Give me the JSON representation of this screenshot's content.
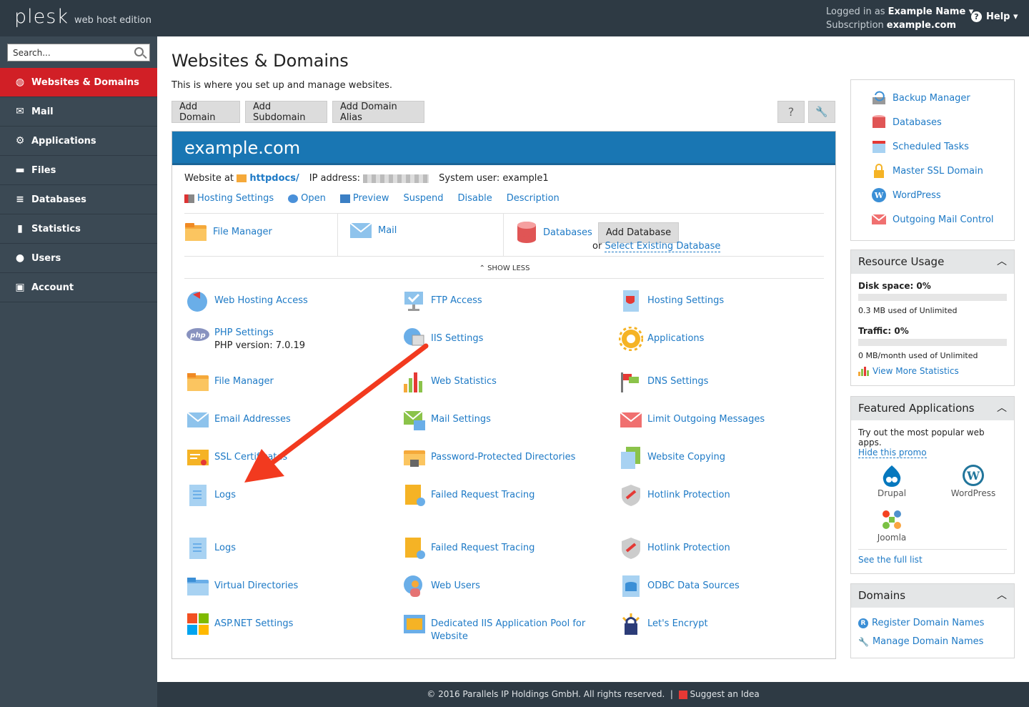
{
  "header": {
    "logo": "plesk",
    "edition": "web host edition",
    "logged_label": "Logged in as",
    "user": "Example Name ▾",
    "sub_label": "Subscription",
    "subscription": "example.com",
    "help": "Help ▾"
  },
  "search": {
    "placeholder": "Search..."
  },
  "nav": [
    {
      "label": "Websites & Domains",
      "icon": "globe-icon"
    },
    {
      "label": "Mail",
      "icon": "mail-icon"
    },
    {
      "label": "Applications",
      "icon": "gear-icon"
    },
    {
      "label": "Files",
      "icon": "folder-icon"
    },
    {
      "label": "Databases",
      "icon": "database-icon"
    },
    {
      "label": "Statistics",
      "icon": "chart-icon"
    },
    {
      "label": "Users",
      "icon": "user-icon"
    },
    {
      "label": "Account",
      "icon": "account-icon"
    }
  ],
  "page": {
    "title": "Websites & Domains",
    "desc": "This is where you set up and manage websites.",
    "btn_add_domain": "Add Domain",
    "btn_add_sub": "Add Subdomain",
    "btn_alias": "Add Domain Alias",
    "btn_help": "?"
  },
  "domain": {
    "name": "example.com",
    "website_at": "Website at",
    "httpdocs": "httpdocs/",
    "ip_label": "IP address:",
    "sysuser_label": "System user:",
    "sysuser": "example1",
    "actions": [
      "Hosting Settings",
      "Open",
      "Preview",
      "Suspend",
      "Disable",
      "Description"
    ],
    "quick": {
      "fm": "File Manager",
      "mail": "Mail",
      "db": "Databases",
      "add_db": "Add Database",
      "or": "or",
      "select_db": "Select Existing Database"
    },
    "show_less": "SHOW LESS",
    "tools": [
      [
        "Web Hosting Access",
        "FTP Access",
        "Hosting Settings"
      ],
      [
        "PHP Settings",
        "IIS Settings",
        "Applications"
      ],
      [
        "File Manager",
        "Web Statistics",
        "DNS Settings"
      ],
      [
        "Email Addresses",
        "Mail Settings",
        "Limit Outgoing Messages"
      ],
      [
        "SSL Certificates",
        "Password-Protected Directories",
        "Website Copying"
      ],
      [
        "Logs",
        "Failed Request Tracing",
        "Hotlink Protection"
      ],
      [
        "Logs",
        "Failed Request Tracing",
        "Hotlink Protection"
      ],
      [
        "Virtual Directories",
        "Web Users",
        "ODBC Data Sources"
      ],
      [
        "ASP.NET Settings",
        "Dedicated IIS Application Pool for Website",
        "Let's Encrypt"
      ]
    ],
    "php_version": "PHP version: 7.0.19"
  },
  "right": {
    "links": [
      "Backup Manager",
      "Databases",
      "Scheduled Tasks",
      "Master SSL Domain",
      "WordPress",
      "Outgoing Mail Control"
    ],
    "resource": {
      "title": "Resource Usage",
      "disk": "Disk space: 0%",
      "disk_used": "0.3 MB used of Unlimited",
      "disk_pct": 0,
      "traffic": "Traffic: 0%",
      "traffic_used": "0 MB/month used of Unlimited",
      "traffic_pct": 0,
      "more": "View More Statistics"
    },
    "featured": {
      "title": "Featured Applications",
      "desc": "Try out the most popular web apps.",
      "hide": "Hide this promo",
      "apps": [
        "Drupal",
        "WordPress",
        "Joomla"
      ],
      "full": "See the full list"
    },
    "domains": {
      "title": "Domains",
      "register": "Register Domain Names",
      "manage": "Manage Domain Names"
    }
  },
  "footer": {
    "copy": "© 2016 Parallels IP Holdings GmbH. All rights reserved.",
    "suggest": "Suggest an Idea"
  },
  "colors": {
    "accent_red": "#d11f26",
    "brand_blue": "#1976b3",
    "sidebar": "#3b4954",
    "topbar": "#2e3a44"
  }
}
